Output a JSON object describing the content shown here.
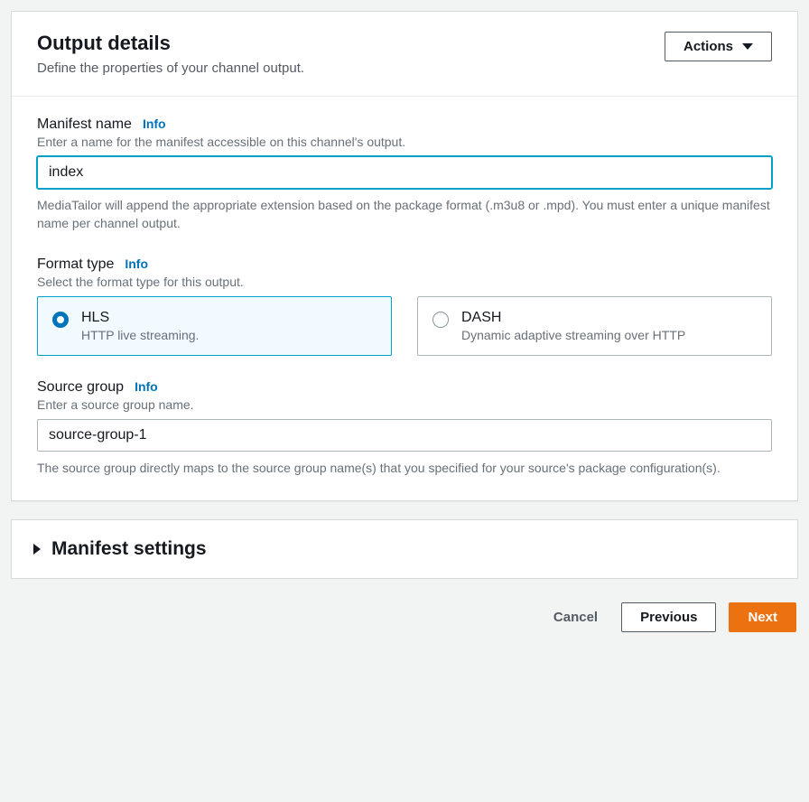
{
  "header": {
    "title": "Output details",
    "subtitle": "Define the properties of your channel output.",
    "actions_label": "Actions"
  },
  "manifest_name": {
    "label": "Manifest name",
    "info": "Info",
    "description": "Enter a name for the manifest accessible on this channel's output.",
    "value": "index",
    "help": "MediaTailor will append the appropriate extension based on the package format (.m3u8 or .mpd). You must enter a unique manifest name per channel output."
  },
  "format_type": {
    "label": "Format type",
    "info": "Info",
    "description": "Select the format type for this output.",
    "options": [
      {
        "title": "HLS",
        "desc": "HTTP live streaming.",
        "selected": true
      },
      {
        "title": "DASH",
        "desc": "Dynamic adaptive streaming over HTTP",
        "selected": false
      }
    ]
  },
  "source_group": {
    "label": "Source group",
    "info": "Info",
    "description": "Enter a source group name.",
    "value": "source-group-1",
    "help": "The source group directly maps to the source group name(s) that you specified for your source's package configuration(s)."
  },
  "manifest_settings": {
    "title": "Manifest settings"
  },
  "footer": {
    "cancel": "Cancel",
    "previous": "Previous",
    "next": "Next"
  }
}
